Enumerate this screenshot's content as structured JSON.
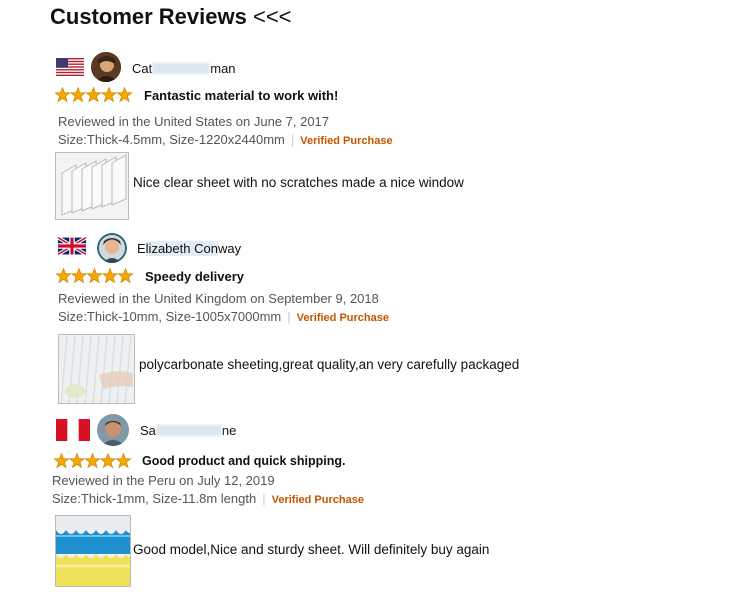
{
  "header": {
    "title": "Customer Reviews",
    "arrows": "<<<"
  },
  "colors": {
    "star": "#f7a600",
    "verified": "#c45500",
    "name_blur": "#dce6ef"
  },
  "reviews": [
    {
      "flag_icon": "us-flag-icon",
      "name_parts": [
        "Cat",
        "",
        "man"
      ],
      "rating": 5,
      "title": "Fantastic material to work with!",
      "meta": "Reviewed in the United States on June 7, 2017",
      "size": "Size:Thick-4.5mm, Size-1220x2440mm",
      "verified": "Verified Purchase",
      "text": "Nice clear sheet with no scratches made a nice window"
    },
    {
      "flag_icon": "uk-flag-icon",
      "name_parts": [
        "E",
        "lizabeth Con",
        "way"
      ],
      "rating": 5,
      "title": "Speedy delivery",
      "meta": "Reviewed in the United Kingdom on September 9, 2018",
      "size": "Size:Thick-10mm, Size-1005x7000mm",
      "verified": "Verified Purchase",
      "text": "polycarbonate sheeting,great quality,an very carefully packaged"
    },
    {
      "flag_icon": "peru-flag-icon",
      "name_parts": [
        "Sa",
        "",
        "ne"
      ],
      "rating": 5,
      "title": "Good product and quick shipping.",
      "meta": "Reviewed in the Peru on July 12, 2019",
      "size": "Size:Thick-1mm, Size-11.8m length",
      "verified": "Verified Purchase",
      "text": "Good model,Nice and sturdy sheet. Will definitely buy again"
    }
  ]
}
